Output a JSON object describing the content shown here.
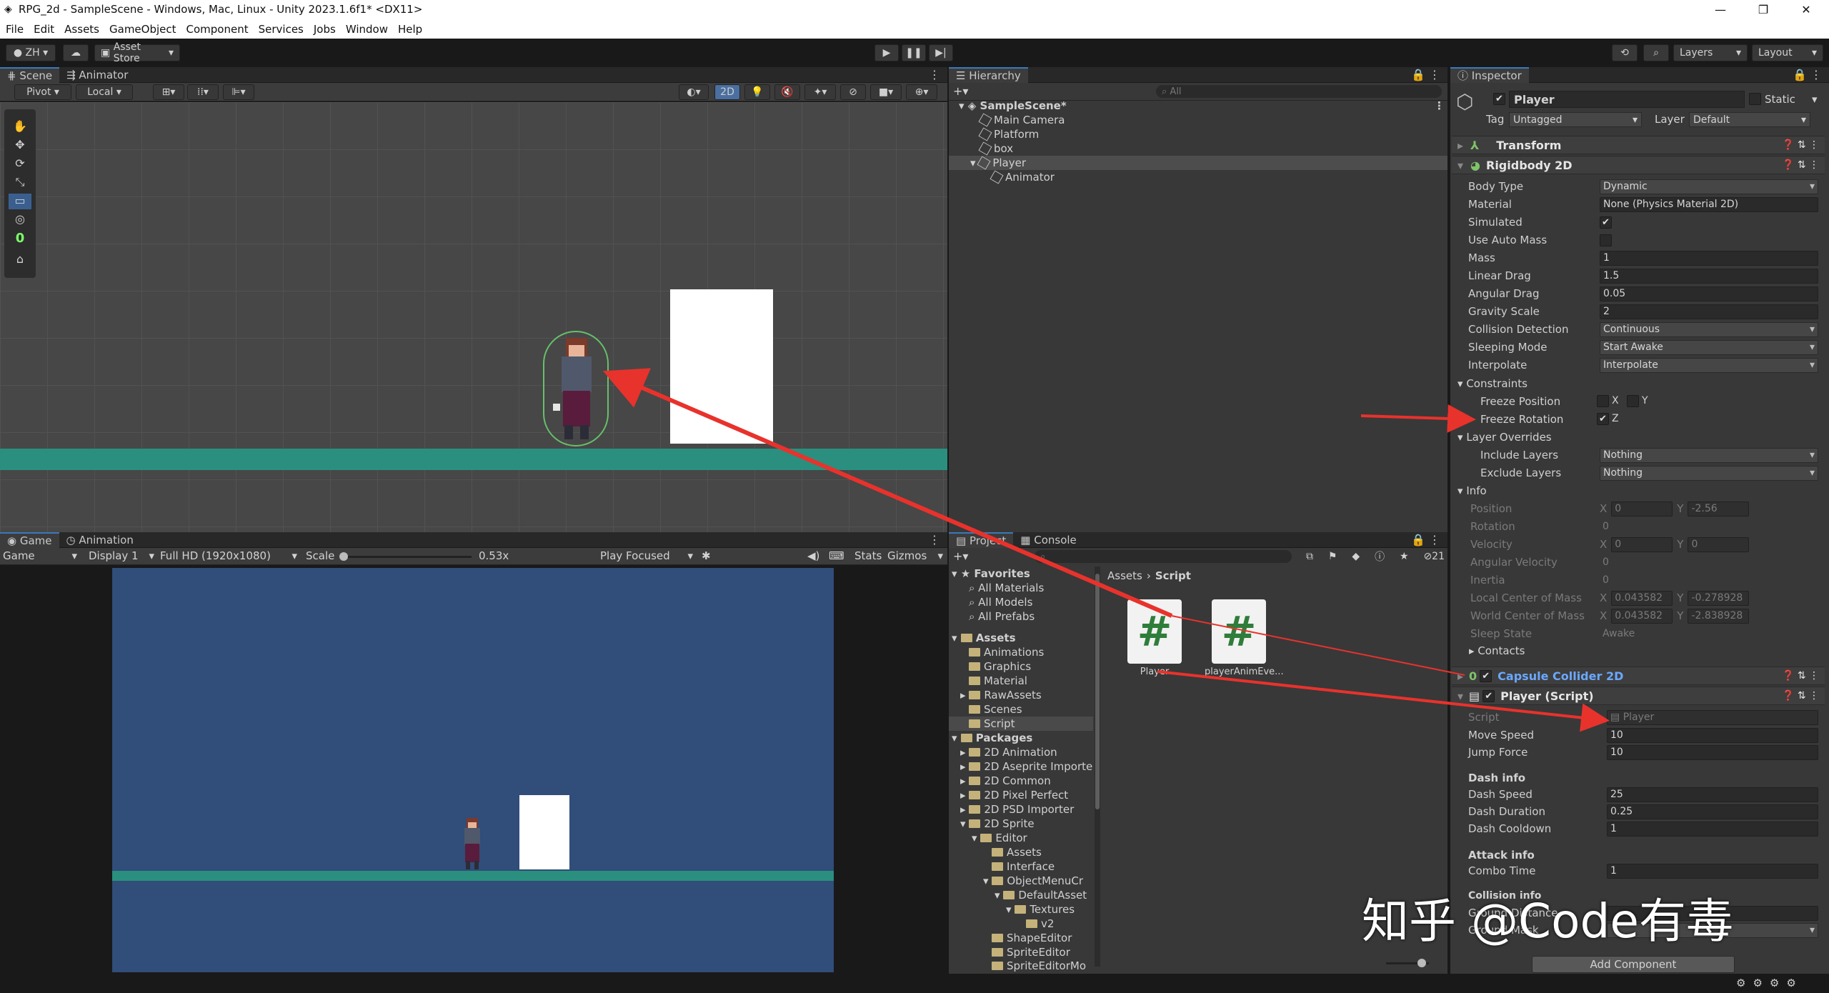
{
  "window": {
    "title": "RPG_2d - SampleScene - Windows, Mac, Linux - Unity 2023.1.6f1* <DX11>",
    "min": "—",
    "max": "❐",
    "close": "✕"
  },
  "menu": [
    "File",
    "Edit",
    "Assets",
    "GameObject",
    "Component",
    "Services",
    "Jobs",
    "Window",
    "Help"
  ],
  "toolbar": {
    "account": "ZH",
    "asset_store": "Asset Store",
    "layers": "Layers",
    "layout": "Layout"
  },
  "scene": {
    "tabs": [
      "Scene",
      "Animator"
    ],
    "pivot": "Pivot",
    "local": "Local",
    "mode_2d": "2D",
    "grid_counter": "0"
  },
  "game": {
    "tabs": [
      "Game",
      "Animation"
    ],
    "mode": "Game",
    "display": "Display 1",
    "resolution": "Full HD (1920x1080)",
    "scale_label": "Scale",
    "scale_value": "0.53x",
    "play_focused": "Play Focused",
    "stats": "Stats",
    "gizmos": "Gizmos"
  },
  "hierarchy": {
    "tab": "Hierarchy",
    "search_placeholder": "All",
    "scene": "SampleScene*",
    "items": [
      "Main Camera",
      "Platform",
      "box",
      "Player",
      "Animator"
    ]
  },
  "project": {
    "tabs": [
      "Project",
      "Console"
    ],
    "badge": "21",
    "breadcrumb_root": "Assets",
    "breadcrumb_leaf": "Script",
    "favorites": "Favorites",
    "fav_items": [
      "All Materials",
      "All Models",
      "All Prefabs"
    ],
    "assets": "Assets",
    "asset_folders": [
      "Animations",
      "Graphics",
      "Material",
      "RawAssets",
      "Scenes",
      "Script"
    ],
    "packages": "Packages",
    "package_items": [
      "2D Animation",
      "2D Aseprite Importe",
      "2D Common",
      "2D Pixel Perfect",
      "2D PSD Importer",
      "2D Sprite",
      "Editor",
      "Assets",
      "Interface",
      "ObjectMenuCr",
      "DefaultAsset",
      "Textures",
      "v2",
      "ShapeEditor",
      "SpriteEditor",
      "SpriteEditorMo"
    ],
    "files": [
      {
        "name": "Player",
        "glyph": "#"
      },
      {
        "name": "playerAnimEve...",
        "glyph": "#"
      }
    ]
  },
  "inspector": {
    "tab": "Inspector",
    "object": "Player",
    "static": "Static",
    "tag_label": "Tag",
    "tag": "Untagged",
    "layer_label": "Layer",
    "layer": "Default",
    "transform": "Transform",
    "rigidbody": "Rigidbody 2D",
    "rb": [
      {
        "label": "Body Type",
        "value": "Dynamic"
      },
      {
        "label": "Material",
        "value": "None (Physics Material 2D)"
      },
      {
        "label": "Simulated",
        "value": "✔"
      },
      {
        "label": "Use Auto Mass",
        "value": ""
      },
      {
        "label": "Mass",
        "value": "1"
      },
      {
        "label": "Linear Drag",
        "value": "1.5"
      },
      {
        "label": "Angular Drag",
        "value": "0.05"
      },
      {
        "label": "Gravity Scale",
        "value": "2"
      },
      {
        "label": "Collision Detection",
        "value": "Continuous"
      },
      {
        "label": "Sleeping Mode",
        "value": "Start Awake"
      },
      {
        "label": "Interpolate",
        "value": "Interpolate"
      }
    ],
    "constraints": "Constraints",
    "freeze_position": "Freeze Position",
    "fp_x": "X",
    "fp_y": "Y",
    "freeze_rotation": "Freeze Rotation",
    "fr_z": "Z",
    "layer_overrides": "Layer Overrides",
    "include_layers": "Include Layers",
    "include_value": "Nothing",
    "exclude_layers": "Exclude Layers",
    "exclude_value": "Nothing",
    "info": "Info",
    "info_rows": [
      {
        "label": "Position",
        "x": "0",
        "y": "-2.56"
      },
      {
        "label": "Rotation",
        "v": "0"
      },
      {
        "label": "Velocity",
        "x": "0",
        "y": "0"
      },
      {
        "label": "Angular Velocity",
        "v": "0"
      },
      {
        "label": "Inertia",
        "v": "0"
      },
      {
        "label": "Local Center of Mass",
        "x": "0.043582",
        "y": "-0.278928"
      },
      {
        "label": "World Center of Mass",
        "x": "0.043582",
        "y": "-2.838928"
      },
      {
        "label": "Sleep State",
        "v": "Awake"
      }
    ],
    "contacts": "Contacts",
    "capsule": "Capsule Collider 2D",
    "script_comp": "Player (Script)",
    "script_label": "Script",
    "script_value": "Player",
    "move_speed_label": "Move Speed",
    "move_speed": "10",
    "jump_force_label": "Jump Force",
    "jump_force": "10",
    "dash_info": "Dash info",
    "dash_speed_label": "Dash Speed",
    "dash_speed": "25",
    "dash_duration_label": "Dash Duration",
    "dash_duration": "0.25",
    "dash_cooldown_label": "Dash Cooldown",
    "dash_cooldown": "1",
    "attack_info": "Attack info",
    "combo_time_label": "Combo Time",
    "combo_time": "1",
    "collision_info": "Collision info",
    "ground_distance": "Ground Distance",
    "ground_mask": "Ground Mask",
    "add_component": "Add Component"
  },
  "watermark": "知乎 @Code有毒",
  "colors": {
    "accent": "#3a79bb",
    "arrow": "#e8322c",
    "ground": "#2a8f7e",
    "game_bg": "#314d79",
    "capsule": "#66c06a"
  }
}
